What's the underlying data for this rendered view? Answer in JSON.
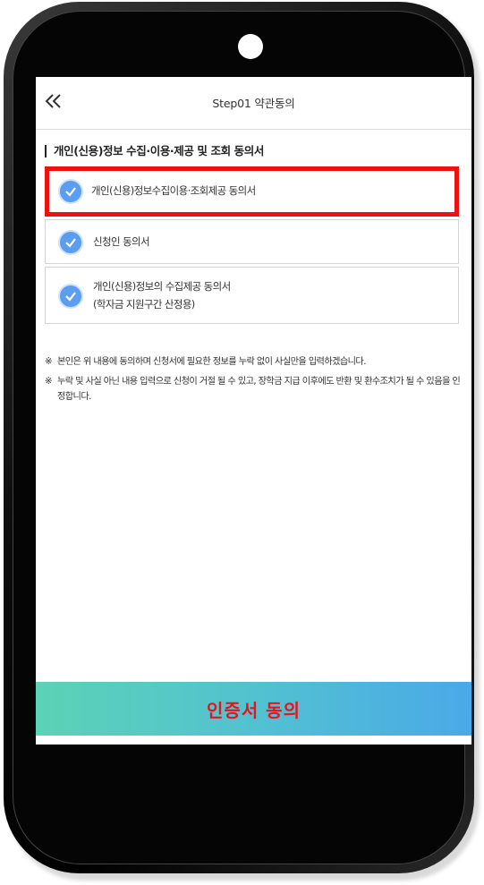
{
  "header": {
    "back_icon": "double-chevron-left-icon",
    "title": "Step01 약관동의"
  },
  "section": {
    "title": "개인(신용)정보 수집·이용·제공 및 조회 동의서"
  },
  "agreements": [
    {
      "label": "개인(신용)정보수집이용·조회제공 동의서",
      "checked": true,
      "highlighted": true
    },
    {
      "label": "신청인 동의서",
      "checked": true
    },
    {
      "label_line1": "개인(신용)정보의 수집제공 동의서",
      "label_line2": "(학자금 지원구간 산정용)",
      "checked": true
    }
  ],
  "notices": [
    {
      "mark": "※",
      "text": "본인은 위 내용에 동의하며 신청서에 필요한 정보를 누락 없이 사실만을 입력하겠습니다."
    },
    {
      "mark": "※",
      "text": "누락 및 사실 아닌 내용 입력으로 신청이 거절 될 수 있고, 장학금 지급 이후에도 반환 및 환수조치가 될 수 있음을 인정합니다."
    }
  ],
  "footer": {
    "button_label": "인증서 동의"
  },
  "colors": {
    "check": "#5b9df0",
    "highlight_border": "#ee1111",
    "button_gradient_start": "#5cd2b6",
    "button_gradient_end": "#4aa9e8",
    "button_text": "#e8141b"
  }
}
